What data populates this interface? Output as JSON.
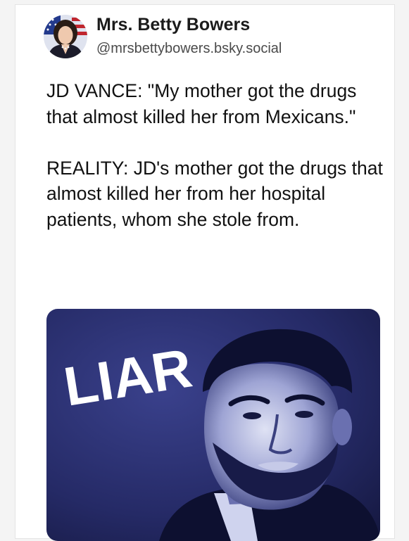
{
  "post": {
    "author": {
      "name": "Mrs. Betty Bowers",
      "handle": "@mrsbettybowers.bsky.social"
    },
    "text": {
      "paragraph1": "JD VANCE: \"My mother got the drugs that almost killed her from Mexicans.\"",
      "paragraph2": "REALITY: JD's mother got the drugs that almost killed her from her hospital patients, whom she stole from."
    },
    "image": {
      "overlay_text": "LIAR"
    }
  },
  "colors": {
    "image_bg": "#2a2f6e",
    "image_dark": "#0d1030",
    "image_light": "#dfe2f4"
  }
}
